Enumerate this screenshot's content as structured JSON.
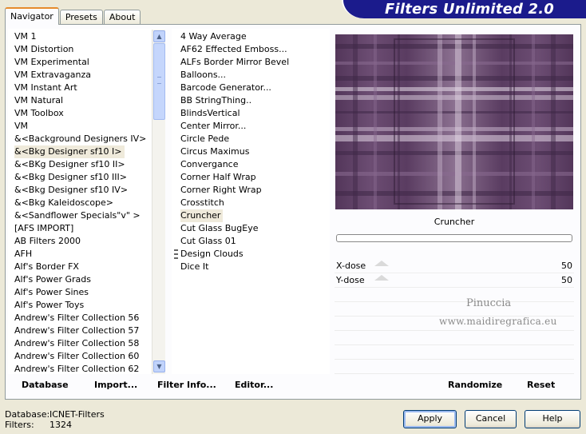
{
  "banner": {
    "title": "Filters Unlimited 2.0"
  },
  "tabs": [
    {
      "label": "Navigator"
    },
    {
      "label": "Presets"
    },
    {
      "label": "About"
    }
  ],
  "categories": [
    "VM 1",
    "VM Distortion",
    "VM Experimental",
    "VM Extravaganza",
    "VM Instant Art",
    "VM Natural",
    "VM Toolbox",
    "VM",
    "&<Background Designers IV>",
    "&<Bkg Designer sf10 I>",
    "&<BKg Designer sf10 II>",
    "&<Bkg Designer sf10 III>",
    "&<Bkg Designer sf10 IV>",
    "&<Bkg Kaleidoscope>",
    "&<Sandflower Specials\"v\" >",
    "[AFS IMPORT]",
    "AB Filters 2000",
    "AFH",
    "Alf's Border FX",
    "Alf's Power Grads",
    "Alf's Power Sines",
    "Alf's Power Toys",
    "Andrew's Filter Collection 56",
    "Andrew's Filter Collection 57",
    "Andrew's Filter Collection 58",
    "Andrew's Filter Collection 60",
    "Andrew's Filter Collection 62"
  ],
  "filters": [
    "4 Way Average",
    "AF62 Effected Emboss...",
    "ALFs Border Mirror Bevel",
    "Balloons...",
    "Barcode Generator...",
    "BB StringThing..",
    "BlindsVertical",
    "Center Mirror...",
    "Circle Pede",
    "Circus Maximus",
    "Convergance",
    "Corner Half Wrap",
    "Corner Right Wrap",
    "Crosstitch",
    "Cruncher",
    "Cut Glass  BugEye",
    "Cut Glass 01",
    "Design Clouds",
    "Dice It"
  ],
  "selected_filter_name": "Cruncher",
  "params": [
    {
      "label": "X-dose",
      "value": "50"
    },
    {
      "label": "Y-dose",
      "value": "50"
    }
  ],
  "watermark": {
    "line1": "Pinuccia",
    "line2": "www.maidiregrafica.eu"
  },
  "bottom_links": {
    "database": "Database",
    "import": "Import...",
    "filter_info": "Filter Info...",
    "editor": "Editor...",
    "randomize": "Randomize",
    "reset": "Reset"
  },
  "status": {
    "database_label": "Database:",
    "database_value": "ICNET-Filters",
    "filters_label": "Filters:",
    "filters_value": "1324"
  },
  "buttons": {
    "apply": "Apply",
    "cancel": "Cancel",
    "help": "Help"
  },
  "colors": {
    "banner": "#1b1b8c",
    "preview_base": "#5f3f66",
    "tab_accent": "#e68b2c"
  }
}
